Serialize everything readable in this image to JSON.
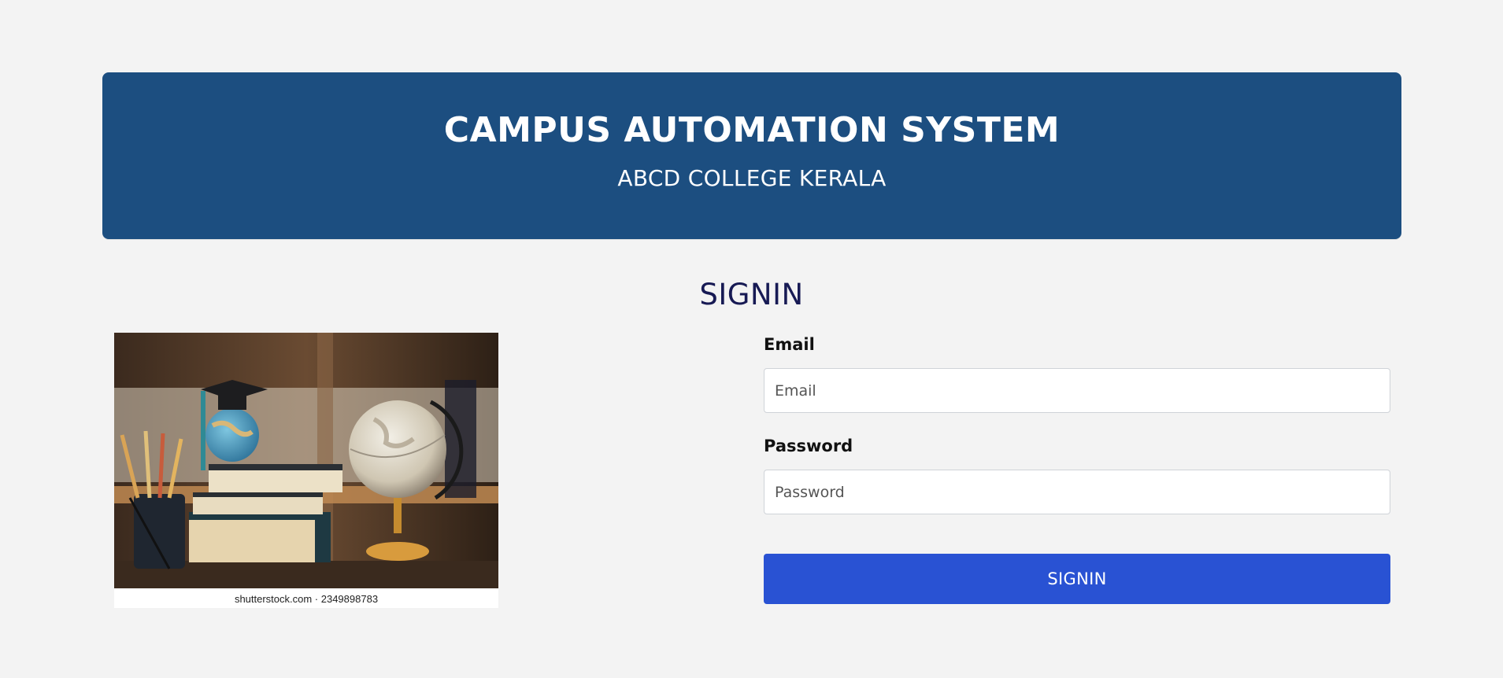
{
  "header": {
    "title": "CAMPUS AUTOMATION SYSTEM",
    "subtitle": "ABCD COLLEGE KERALA"
  },
  "signin": {
    "heading": "SIGNIN",
    "email_label": "Email",
    "email_placeholder": "Email",
    "email_value": "",
    "password_label": "Password",
    "password_placeholder": "Password",
    "password_value": "",
    "button_label": "SIGNIN"
  },
  "image": {
    "caption": "shutterstock.com · 2349898783"
  },
  "colors": {
    "page_background": "#f3f3f3",
    "header_background": "#1c4e80",
    "heading_text": "#171a54",
    "button_background": "#2952d3"
  },
  "icons": {
    "hero": "books-globe-graduation-cap-illustration"
  }
}
